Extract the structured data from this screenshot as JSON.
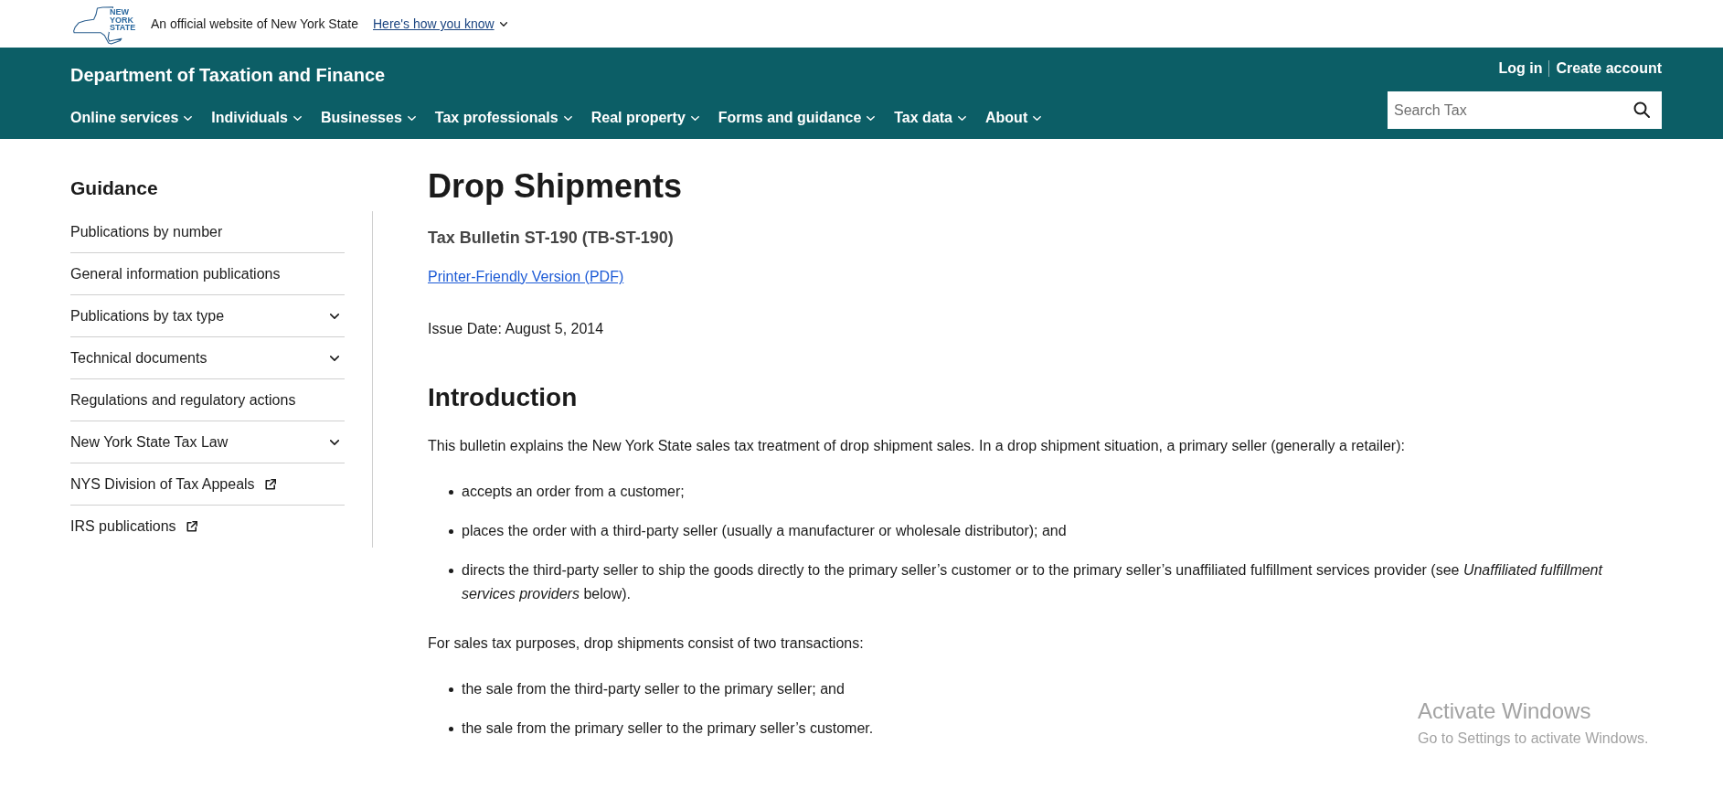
{
  "top_bar": {
    "logo": {
      "lines": [
        "NEW",
        "YORK",
        "STATE"
      ]
    },
    "text": "An official website of New York State",
    "link": "Here's how you know"
  },
  "header": {
    "title": "Department of Taxation and Finance",
    "account_links": [
      "Log in",
      "Create account"
    ],
    "search": {
      "placeholder": "Search Tax"
    },
    "nav": [
      {
        "label": "Online services"
      },
      {
        "label": "Individuals"
      },
      {
        "label": "Businesses"
      },
      {
        "label": "Tax professionals"
      },
      {
        "label": "Real property"
      },
      {
        "label": "Forms and guidance"
      },
      {
        "label": "Tax data"
      },
      {
        "label": "About"
      }
    ]
  },
  "sidebar": {
    "heading": "Guidance",
    "items": [
      {
        "label": "Publications by number",
        "kind": "link"
      },
      {
        "label": "General information publications",
        "kind": "link"
      },
      {
        "label": "Publications by tax type",
        "kind": "expandable"
      },
      {
        "label": "Technical documents",
        "kind": "expandable"
      },
      {
        "label": "Regulations and regulatory actions",
        "kind": "link"
      },
      {
        "label": "New York State Tax Law",
        "kind": "expandable"
      },
      {
        "label": "NYS Division of Tax Appeals",
        "kind": "external"
      },
      {
        "label": "IRS publications",
        "kind": "external"
      }
    ]
  },
  "article": {
    "title": "Drop Shipments",
    "subtitle": "Tax Bulletin ST-190 (TB-ST-190)",
    "pdf_link": "Printer-Friendly Version (PDF)",
    "issue_date": "Issue Date: August 5, 2014",
    "sections": [
      {
        "heading": "Introduction",
        "blocks": [
          {
            "kind": "paragraph",
            "text": "This bulletin explains the New York State sales tax treatment of drop shipment sales. In a drop shipment situation, a primary seller (generally a retailer):"
          },
          {
            "kind": "list",
            "items": [
              "accepts an order from a customer;",
              "places the order with a third-party seller (usually a manufacturer or wholesale distributor); and",
              "directs the third-party seller to ship the goods directly to the primary seller’s customer or to the primary seller’s unaffiliated fulfillment services provider (see *Unaffiliated fulfillment services providers* below)."
            ]
          },
          {
            "kind": "paragraph",
            "text": "For sales tax purposes, drop shipments consist of two transactions:"
          },
          {
            "kind": "list",
            "items": [
              "the sale from the third-party seller to the primary seller; and",
              "the sale from the primary seller to the primary seller’s customer."
            ]
          }
        ]
      }
    ]
  },
  "system_notice": {
    "title": "Activate Windows",
    "message": "Go to Settings to activate Windows."
  }
}
